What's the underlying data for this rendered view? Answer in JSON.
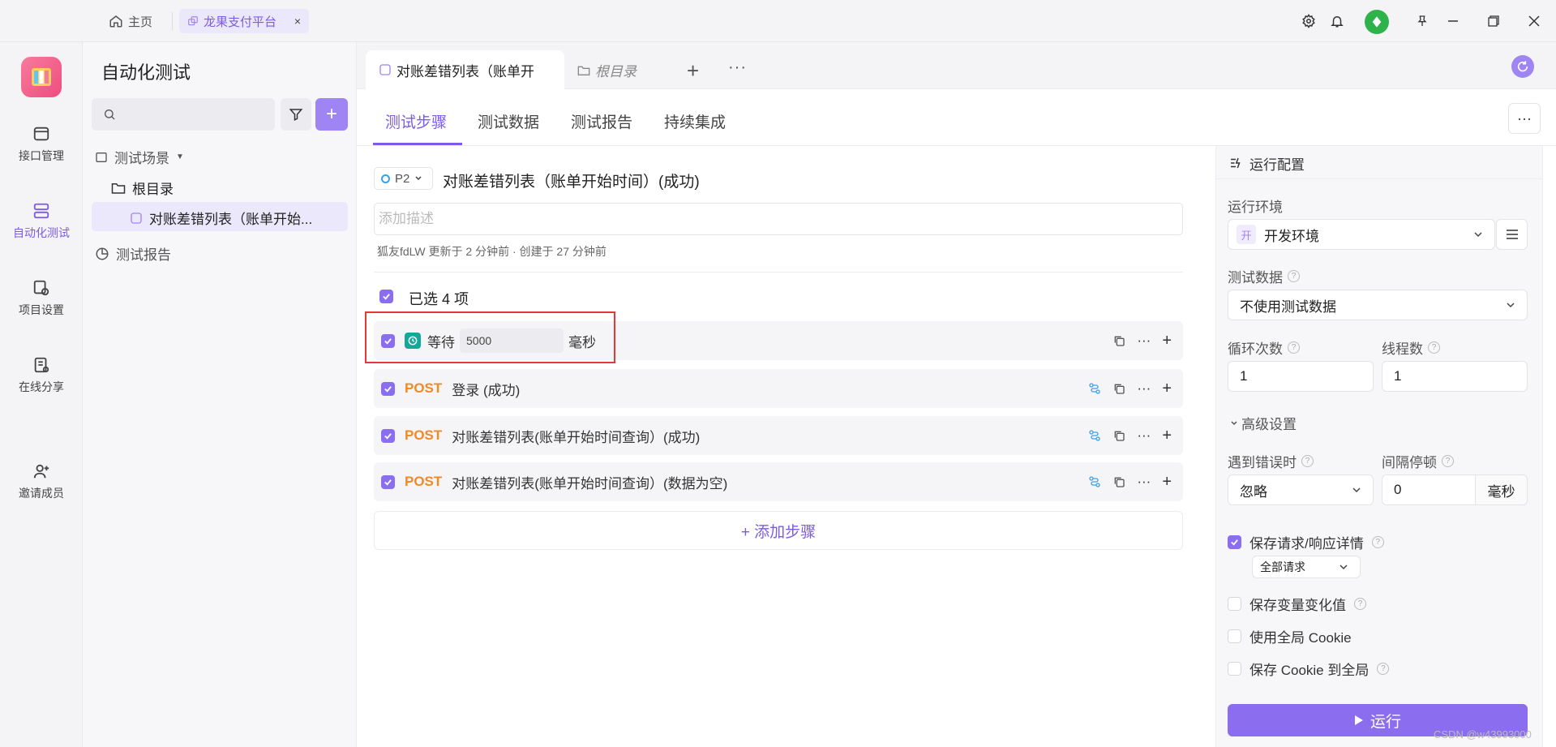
{
  "titlebar": {
    "home_label": "主页",
    "tab_label": "龙果支付平台",
    "tab_close": "×"
  },
  "rail": {
    "items": [
      {
        "label": "接口管理",
        "icon": "api-icon"
      },
      {
        "label": "自动化测试",
        "icon": "automation-icon",
        "active": true
      },
      {
        "label": "项目设置",
        "icon": "project-settings-icon"
      },
      {
        "label": "在线分享",
        "icon": "share-icon"
      },
      {
        "label": "邀请成员",
        "icon": "invite-member-icon"
      }
    ]
  },
  "tree": {
    "title": "自动化测试",
    "search_placeholder": "",
    "scenarios_label": "测试场景",
    "root_label": "根目录",
    "case_label": "对账差错列表（账单开始...",
    "reports_label": "测试报告"
  },
  "tabs": {
    "active_tab": "对账差错列表（账单开",
    "second_tab": "根目录",
    "plus": "+",
    "more": "···"
  },
  "subtabs": [
    "测试步骤",
    "测试数据",
    "测试报告",
    "持续集成"
  ],
  "case": {
    "priority": "P2",
    "title": "对账差错列表（账单开始时间）(成功)",
    "desc_placeholder": "添加描述",
    "meta": "狐友fdLW 更新于 2 分钟前 · 创建于 27 分钟前",
    "selected_label": "已选 4 项"
  },
  "steps": [
    {
      "type": "wait",
      "label": "等待",
      "value": "5000",
      "unit": "毫秒"
    },
    {
      "type": "http",
      "method": "POST",
      "name": "登录 (成功)"
    },
    {
      "type": "http",
      "method": "POST",
      "name": "对账差错列表(账单开始时间查询）(成功)"
    },
    {
      "type": "http",
      "method": "POST",
      "name": "对账差错列表(账单开始时间查询）(数据为空)"
    }
  ],
  "add_step_label": "+ 添加步骤",
  "run_config": {
    "title": "运行配置",
    "env_label": "运行环境",
    "env_badge": "开",
    "env_value": "开发环境",
    "data_label": "测试数据",
    "data_value": "不使用测试数据",
    "loops_label": "循环次数",
    "loops_value": "1",
    "threads_label": "线程数",
    "threads_value": "1",
    "advanced_label": "高级设置",
    "on_error_label": "遇到错误时",
    "on_error_value": "忽略",
    "interval_label": "间隔停顿",
    "interval_value": "0",
    "interval_unit": "毫秒",
    "save_details_label": "保存请求/响应详情",
    "save_details_checked": true,
    "save_details_scope": "全部请求",
    "save_vars_label": "保存变量变化值",
    "global_cookie_label": "使用全局 Cookie",
    "save_cookie_label": "保存 Cookie 到全局",
    "run_label": "运行"
  },
  "watermark": "CSDN @w43993000",
  "colors": {
    "accent": "#7b5be8",
    "post": "#f08a24",
    "highlight": "#e5383b"
  }
}
